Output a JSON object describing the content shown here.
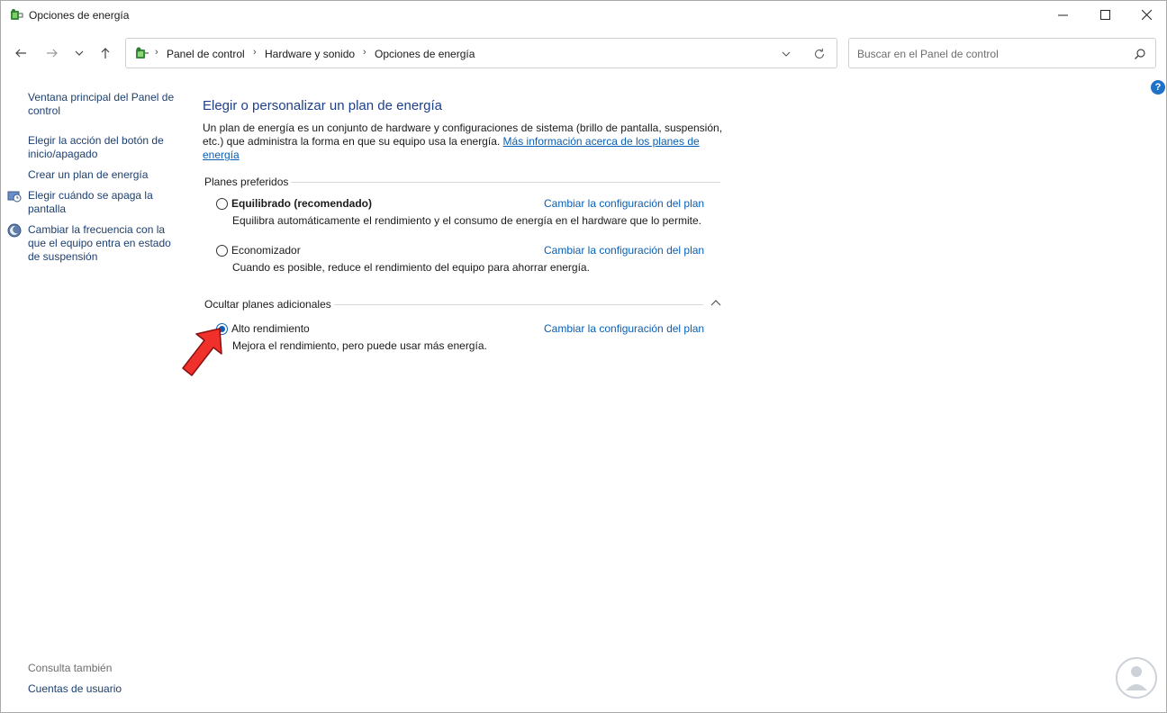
{
  "window": {
    "title": "Opciones de energía",
    "minimize_icon": "minimize-icon",
    "maximize_icon": "maximize-icon",
    "close_icon": "close-icon"
  },
  "nav": {
    "back_icon": "back-arrow-icon",
    "forward_icon": "forward-arrow-icon",
    "recent_icon": "chevron-down-icon",
    "up_icon": "up-arrow-icon"
  },
  "address": {
    "crumbs": [
      "Panel de control",
      "Hardware y sonido",
      "Opciones de energía"
    ],
    "separator": "›"
  },
  "search": {
    "placeholder": "Buscar en el Panel de control"
  },
  "help": {
    "label": "?"
  },
  "sidebar": {
    "items": [
      {
        "label": "Ventana principal del Panel de control"
      },
      {
        "label": "Elegir la acción del botón de inicio/apagado"
      },
      {
        "label": "Crear un plan de energía"
      },
      {
        "label": "Elegir cuándo se apaga la pantalla"
      },
      {
        "label": "Cambiar la frecuencia con la que el equipo entra en estado de suspensión"
      }
    ],
    "see_also": "Consulta también",
    "see_also_items": [
      {
        "label": "Cuentas de usuario"
      }
    ]
  },
  "main": {
    "title": "Elegir o personalizar un plan de energía",
    "intro": "Un plan de energía es un conjunto de hardware y configuraciones de sistema (brillo de pantalla, suspensión, etc.) que administra la forma en que su equipo usa la energía.",
    "intro_link": "Más información acerca de los planes de energía",
    "preferred_heading": "Planes preferidos",
    "additional_heading": "Ocultar planes adicionales",
    "change_label": "Cambiar la configuración del plan",
    "plans": [
      {
        "name": "Equilibrado (recomendado)",
        "desc": "Equilibra automáticamente el rendimiento y el consumo de energía en el hardware que lo permite.",
        "selected": false
      },
      {
        "name": "Economizador",
        "desc": "Cuando es posible, reduce el rendimiento del equipo para ahorrar energía.",
        "selected": false
      },
      {
        "name": "Alto rendimiento",
        "desc": "Mejora el rendimiento, pero puede usar más energía.",
        "selected": true
      }
    ]
  },
  "colors": {
    "accent": "#0a5fb4",
    "title": "#1e3f8a",
    "pointer": "#e53935"
  }
}
